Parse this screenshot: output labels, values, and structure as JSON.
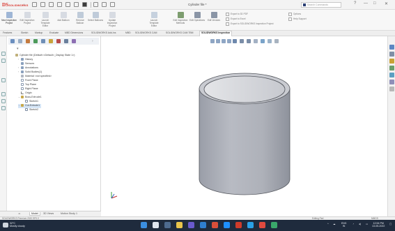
{
  "app": {
    "logo_mark": "DS",
    "logo_text": "SOLIDWORKS",
    "document_title": "Cylinder file *",
    "search_placeholder": "Search Commands",
    "window_controls": [
      "?",
      "—",
      "□",
      "✕"
    ]
  },
  "command_manager": {
    "tools": [
      {
        "label": "New Inspection Project",
        "icon": "new-inspection-project-icon",
        "active": true
      },
      {
        "label": "Edit Inspection Project",
        "icon": "edit-inspection-project-icon"
      },
      {
        "label": "Launch Template Editor",
        "icon": "launch-template-editor-icon"
      },
      {
        "label": "Add Balloon",
        "icon": "add-balloon-icon"
      },
      {
        "label": "Remove Balloon",
        "icon": "remove-balloon-icon"
      },
      {
        "label": "Select Balloons",
        "icon": "select-balloons-icon"
      },
      {
        "label": "Update Inspection Project",
        "icon": "update-inspection-project-icon"
      },
      {
        "label": "Launch Template Editor",
        "icon": "template-editor-icon"
      },
      {
        "label": "Edit Inspection Methods",
        "icon": "edit-methods-icon"
      },
      {
        "label": "Edit Operations",
        "icon": "edit-operations-icon"
      },
      {
        "label": "Edit Vendors",
        "icon": "edit-vendors-icon"
      }
    ],
    "small_tools": [
      "Export to 3D PDF",
      "Export to Excel",
      "Export to SOLIDWORKS Inspection Project",
      "Options",
      "Help Support"
    ]
  },
  "tabs": [
    {
      "label": "Features"
    },
    {
      "label": "Sketch"
    },
    {
      "label": "Markup"
    },
    {
      "label": "Evaluate"
    },
    {
      "label": "MBD Dimensions"
    },
    {
      "label": "SOLIDWORKS Add-Ins"
    },
    {
      "label": "MBD"
    },
    {
      "label": "SOLIDWORKS CAM"
    },
    {
      "label": "SOLIDWORKS CAM TBM"
    },
    {
      "label": "SOLIDWORKS Inspection",
      "active": true
    }
  ],
  "feature_tree": {
    "root": "Cylinder file (Default<<Default>_Display State 1>)",
    "items": [
      {
        "label": "History",
        "icon": "history-icon",
        "level": 1
      },
      {
        "label": "Sensors",
        "icon": "sensors-icon",
        "level": 1
      },
      {
        "label": "Annotations",
        "icon": "annotations-icon",
        "level": 1
      },
      {
        "label": "Solid Bodies(1)",
        "icon": "solid-bodies-icon",
        "level": 1
      },
      {
        "label": "Material <not specified>",
        "icon": "material-icon",
        "level": 1
      },
      {
        "label": "Front Plane",
        "icon": "plane-icon",
        "level": 1
      },
      {
        "label": "Top Plane",
        "icon": "plane-icon",
        "level": 1
      },
      {
        "label": "Right Plane",
        "icon": "plane-icon",
        "level": 1
      },
      {
        "label": "Origin",
        "icon": "origin-icon",
        "level": 1
      },
      {
        "label": "Boss-Extrude1",
        "icon": "boss-extrude-icon",
        "level": 1
      },
      {
        "label": "Sketch1",
        "icon": "sketch-icon",
        "level": 2
      },
      {
        "label": "Cut-Extrude1",
        "icon": "cut-extrude-icon",
        "level": 1,
        "selected": true
      },
      {
        "label": "Sketch2",
        "icon": "sketch-icon",
        "level": 2
      }
    ]
  },
  "bottom_tabs": [
    {
      "label": "Model",
      "active": true
    },
    {
      "label": "3D Views"
    },
    {
      "label": "Motion Study 1"
    }
  ],
  "status_bar": {
    "left": "SOLIDWORKS Premium 2020 SP0.0",
    "editing": "Editing Part",
    "units": "MMGS"
  },
  "taskbar": {
    "weather_temp": "32°C",
    "weather_desc": "Mostly cloudy",
    "lang": "ENG",
    "lang_sub": "IN",
    "time": "12:54 PM",
    "date": "13-05-2022"
  },
  "colors": {
    "accent": "#2e64b5",
    "brand_red": "#d9322a",
    "taskbar": "#1f2b3d",
    "cylinder_gray": "#a7abb5"
  }
}
